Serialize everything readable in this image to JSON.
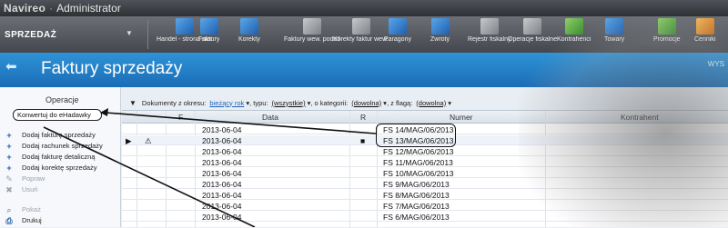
{
  "window": {
    "app": "Navireo",
    "separator": "·",
    "role": "Administrator"
  },
  "ribbon": {
    "module": "SPRZEDAŻ",
    "buttons": [
      {
        "label": "Handel - strona start...",
        "icon": "home-icon",
        "color": "blue"
      },
      {
        "label": "Faktury",
        "icon": "invoice-icon",
        "color": "blue"
      },
      {
        "label": "Korekty",
        "icon": "correction-icon",
        "color": "blue"
      },
      {
        "label": "Faktury wew. podatku nal...",
        "icon": "internal-invoice-icon",
        "color": "gray"
      },
      {
        "label": "Korekty faktur wew...",
        "icon": "internal-correction-icon",
        "color": "gray"
      },
      {
        "label": "Paragony",
        "icon": "receipt-icon",
        "color": "blue"
      },
      {
        "label": "Zwroty",
        "icon": "return-icon",
        "color": "blue"
      },
      {
        "label": "Rejestr fiskalny",
        "icon": "fiscal-register-icon",
        "color": "gray"
      },
      {
        "label": "Operacje fiskalne",
        "icon": "fiscal-operations-icon",
        "color": "gray"
      },
      {
        "label": "Kontrahenci",
        "icon": "contractors-icon",
        "color": "green"
      },
      {
        "label": "Towary",
        "icon": "goods-icon",
        "color": "blue"
      },
      {
        "label": "Promocje",
        "icon": "promotions-icon",
        "color": "green"
      },
      {
        "label": "Cenniki",
        "icon": "price-list-icon",
        "color": "orange"
      }
    ]
  },
  "header": {
    "title": "Faktury sprzedaży",
    "shortcut": "WYS"
  },
  "left_panel": {
    "title": "Operacje",
    "convert_button": "Konwertuj do eHadawky",
    "items": [
      {
        "label": "Dodaj fakturę sprzedaży",
        "icon": "add-icon",
        "enabled": true
      },
      {
        "label": "Dodaj rachunek sprzedaży",
        "icon": "add-icon",
        "enabled": true
      },
      {
        "label": "Dodaj fakturę detaliczną",
        "icon": "add-icon",
        "enabled": true
      },
      {
        "label": "Dodaj korektę sprzedaży",
        "icon": "add-icon",
        "enabled": true
      },
      {
        "label": "Popraw",
        "icon": "edit-icon",
        "enabled": false
      },
      {
        "label": "Usuń",
        "icon": "delete-icon",
        "enabled": false
      },
      {
        "label": "Pokaż",
        "icon": "view-icon",
        "enabled": false
      },
      {
        "label": "Drukuj",
        "icon": "print-icon",
        "enabled": true
      }
    ]
  },
  "filters": {
    "prefix": "Dokumenty z okresu:",
    "period": "bieżący rok",
    "type_label": ", typu:",
    "type_value": "(wszystkie)",
    "category_label": ", o kategorii:",
    "category_value": "(dowolna)",
    "flag_label": ", z flagą:",
    "flag_value": "(dowolna)"
  },
  "grid": {
    "columns": [
      "",
      "",
      "F",
      "Data",
      "R",
      "Numer",
      "Kontrahent"
    ],
    "rows": [
      {
        "date": "2013-06-04",
        "number": "FS 14/MAG/06/2013",
        "r": "",
        "warn": false,
        "current": false
      },
      {
        "date": "2013-06-04",
        "number": "FS 13/MAG/06/2013",
        "r": "■",
        "warn": true,
        "current": true
      },
      {
        "date": "2013-06-04",
        "number": "FS 12/MAG/06/2013",
        "r": "",
        "warn": false,
        "current": false
      },
      {
        "date": "2013-06-04",
        "number": "FS 11/MAG/06/2013",
        "r": "",
        "warn": false,
        "current": false
      },
      {
        "date": "2013-06-04",
        "number": "FS 10/MAG/06/2013",
        "r": "",
        "warn": false,
        "current": false
      },
      {
        "date": "2013-06-04",
        "number": "FS 9/MAG/06/2013",
        "r": "",
        "warn": false,
        "current": false
      },
      {
        "date": "2013-06-04",
        "number": "FS 8/MAG/06/2013",
        "r": "",
        "warn": false,
        "current": false
      },
      {
        "date": "2013-06-04",
        "number": "FS 7/MAG/06/2013",
        "r": "",
        "warn": false,
        "current": false
      },
      {
        "date": "2013-06-04",
        "number": "FS 6/MAG/06/2013",
        "r": "",
        "warn": false,
        "current": false
      }
    ]
  }
}
